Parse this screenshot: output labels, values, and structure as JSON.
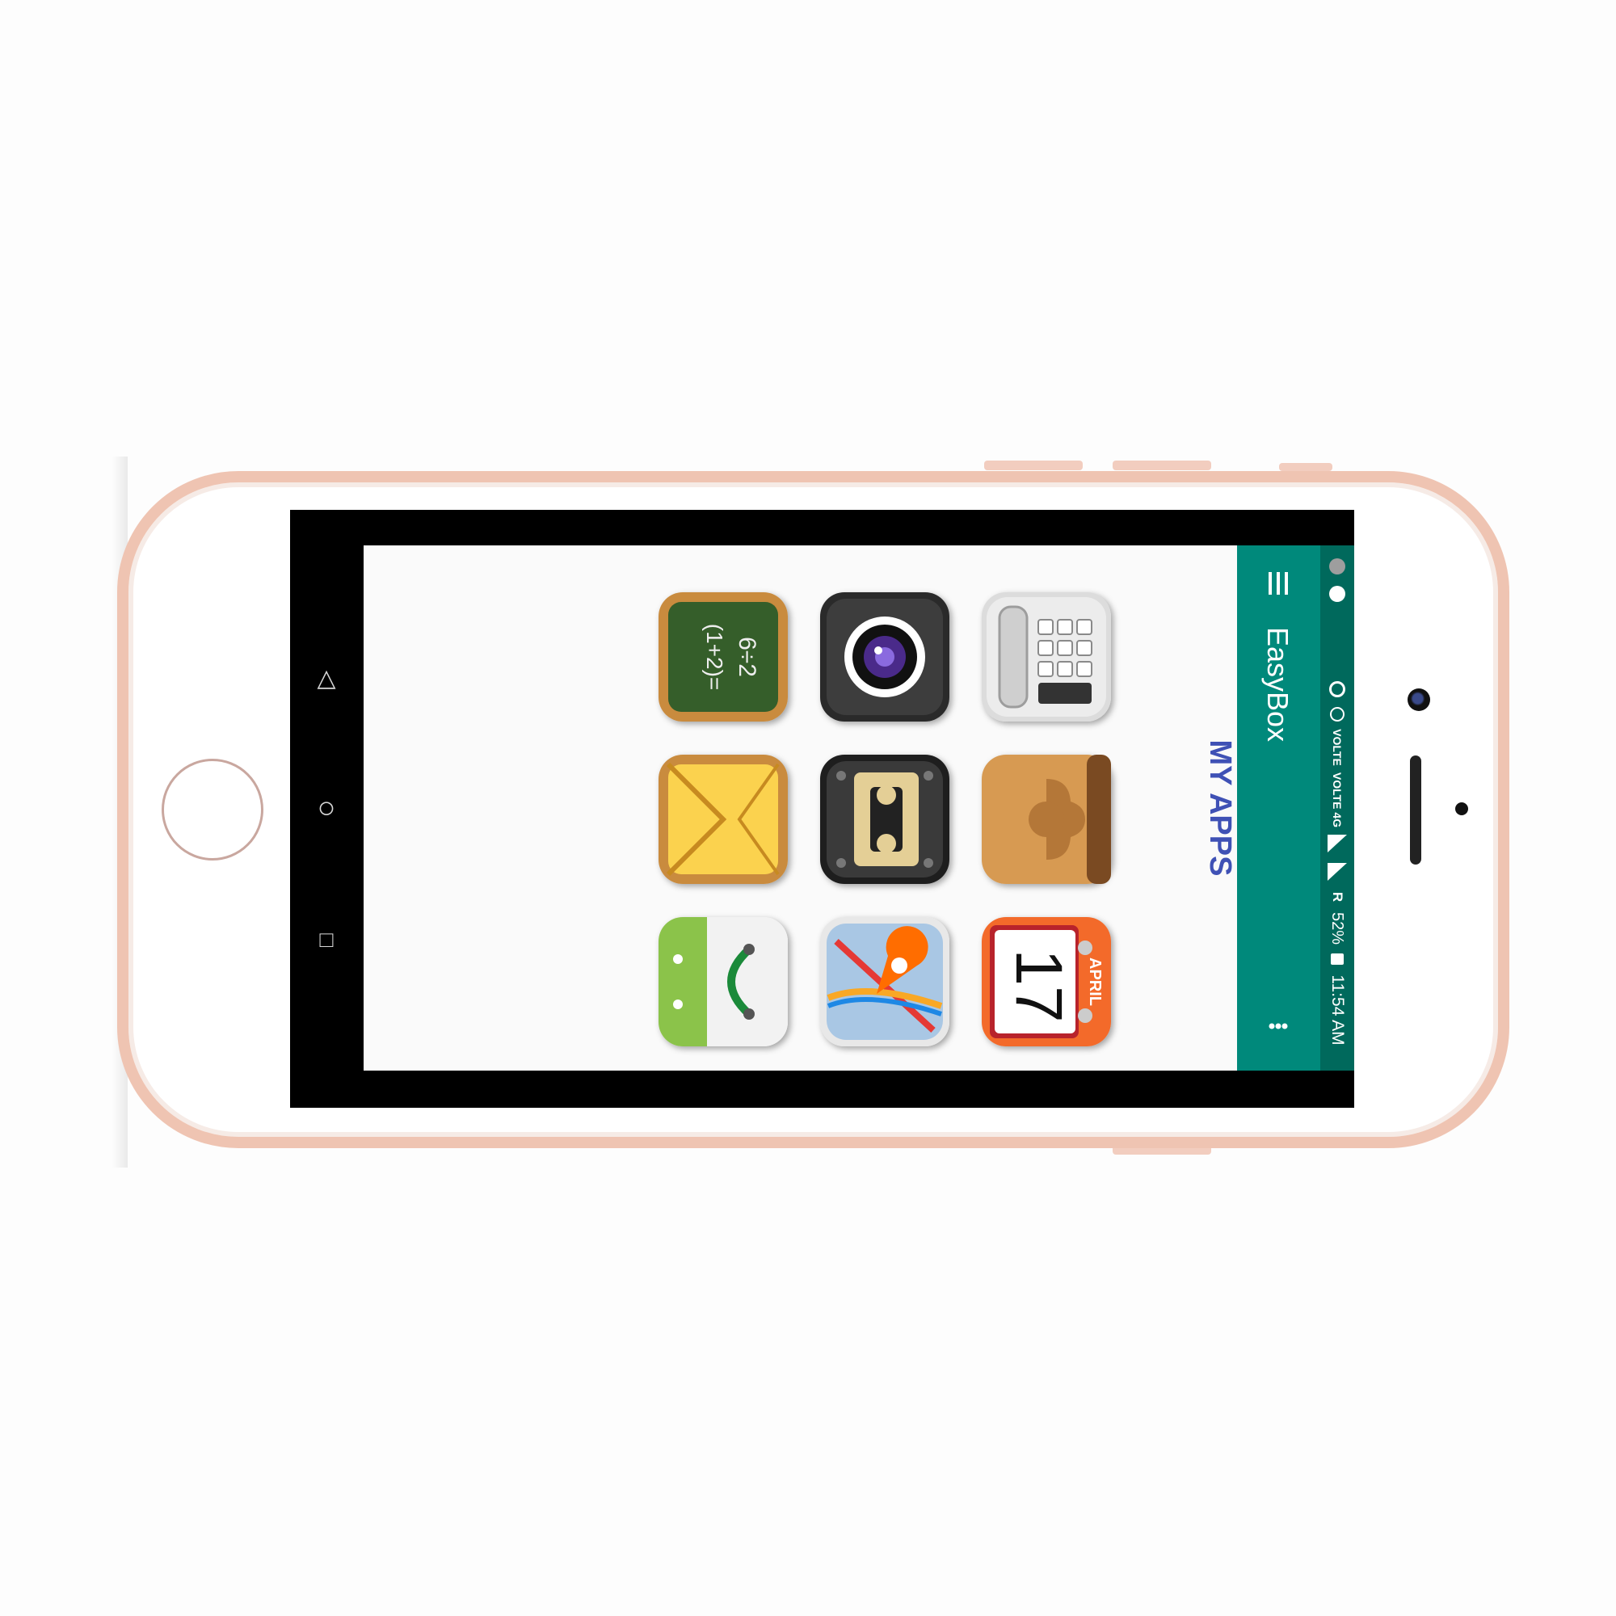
{
  "app": {
    "title": "EasyBox",
    "section_heading": "MY APPS",
    "overflow_icon": "more-vert-icon",
    "menu_icon": "hamburger-icon"
  },
  "status_bar": {
    "time": "11:54 AM",
    "battery": "52%",
    "roaming": "R",
    "network_1": "VOLTE",
    "network_2": "VOLTE 4G"
  },
  "nav_bar": {
    "back_glyph": "△",
    "home_glyph": "○",
    "recent_glyph": "□"
  },
  "apps": [
    {
      "name": "calculator",
      "icon": "calculator-icon"
    },
    {
      "name": "camera",
      "icon": "camera-icon"
    },
    {
      "name": "math",
      "icon": "chalkboard-icon"
    },
    {
      "name": "contacts",
      "icon": "contacts-icon"
    },
    {
      "name": "recorder",
      "icon": "cassette-icon"
    },
    {
      "name": "mail",
      "icon": "envelope-icon"
    },
    {
      "name": "calendar",
      "icon": "calendar-icon",
      "month": "APRIL",
      "day": "17"
    },
    {
      "name": "maps",
      "icon": "map-pin-icon"
    },
    {
      "name": "android-store",
      "icon": "android-bag-icon"
    }
  ],
  "colors": {
    "toolbar": "#00897b",
    "statusbar": "#00695c",
    "heading": "#3f51b5",
    "phone_frame": "#efc4b2"
  }
}
